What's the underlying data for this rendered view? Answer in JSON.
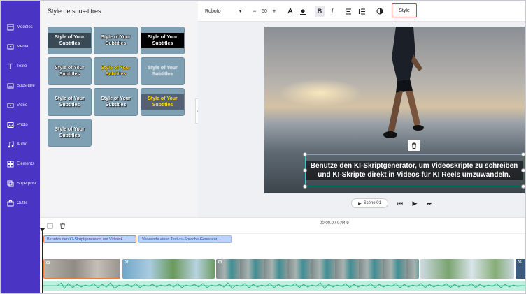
{
  "nav": {
    "items": [
      {
        "label": "Modèles",
        "icon": "template-icon"
      },
      {
        "label": "Média",
        "icon": "media-icon"
      },
      {
        "label": "Texte",
        "icon": "text-icon"
      },
      {
        "label": "Sous-titre",
        "icon": "subtitle-icon"
      },
      {
        "label": "Vidéo",
        "icon": "video-icon"
      },
      {
        "label": "Photo",
        "icon": "photo-icon"
      },
      {
        "label": "Audio",
        "icon": "audio-icon"
      },
      {
        "label": "Éléments",
        "icon": "elements-icon"
      },
      {
        "label": "Superposi...",
        "icon": "overlay-icon"
      },
      {
        "label": "Outils",
        "icon": "tools-icon"
      }
    ]
  },
  "panel": {
    "title": "Style de sous-titres",
    "tiles": [
      "Style of Your Subtitles",
      "Style of Your Subtitles",
      "Style of Your Subtitles",
      "Style of Your Subtitles",
      "Style of Your Subtitles",
      "Style of Your Subtitles",
      "Style of Your Subtitles",
      "Style of Your Subtitles",
      "Style of Your Subtitles",
      "Style of Your Subtitles"
    ]
  },
  "toolbar": {
    "font": "Roboto",
    "font_size": "50",
    "minus": "−",
    "plus": "+",
    "bold": "B",
    "italic": "I",
    "style_label": "Style"
  },
  "preview": {
    "subtitle": "Benutze den KI-Skriptgenerator, um Videoskripte zu schreiben und KI-Skripte direkt in Videos für KI Reels umzuwandeln.",
    "scene_label": "Scène 01"
  },
  "timeline": {
    "time": "00:00.0 / 0:44.9",
    "subtitle_chips": [
      "Benutze den KI-Skriptgenerator, um Videosk...",
      "Verwende einen Text-zu-Sprache-Generator, ..."
    ],
    "clips": [
      "01",
      "02",
      "03",
      "",
      "05"
    ]
  },
  "colors": {
    "nav_bg": "#4a34c4",
    "accent_teal": "#3fc8c0",
    "highlight_red": "#e33a3a"
  }
}
